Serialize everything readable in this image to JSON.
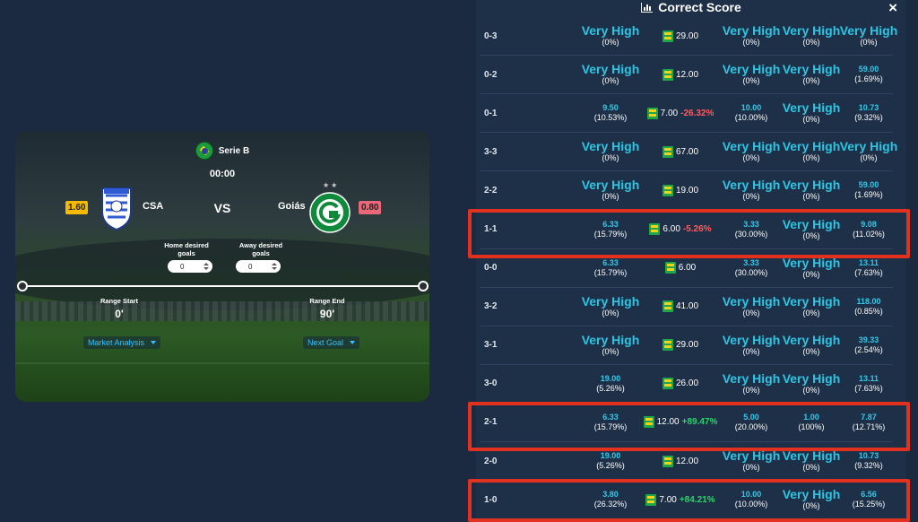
{
  "match": {
    "league": "Serie B",
    "clock": "00:00",
    "home_team": "CSA",
    "away_team": "Goiás",
    "vs": "VS",
    "home_odd": "1.60",
    "away_odd": "0.80",
    "home_goals_label": "Home desired goals",
    "away_goals_label": "Away desired goals",
    "home_goals_value": "0",
    "away_goals_value": "0",
    "range_start_label": "Range Start",
    "range_start_value": "0'",
    "range_end_label": "Range End",
    "range_end_value": "90'",
    "market_analysis": "Market Analysis",
    "next_goal": "Next Goal"
  },
  "panel": {
    "title": "Correct Score",
    "close": "×"
  },
  "rows": [
    {
      "score": "0-3",
      "c1": {
        "v": "Very High",
        "p": "(0%)"
      },
      "bk": "29.00",
      "chg": "",
      "c3": {
        "v": "Very High",
        "p": "(0%)"
      },
      "c4": {
        "v": "Very High",
        "p": "(0%)"
      },
      "c5": {
        "v": "Very High",
        "p": "(0%)"
      }
    },
    {
      "score": "0-2",
      "c1": {
        "v": "Very High",
        "p": "(0%)"
      },
      "bk": "12.00",
      "chg": "",
      "c3": {
        "v": "Very High",
        "p": "(0%)"
      },
      "c4": {
        "v": "Very High",
        "p": "(0%)"
      },
      "c5": {
        "v": "59.00",
        "p": "(1.69%)"
      }
    },
    {
      "score": "0-1",
      "c1": {
        "v": "9.50",
        "p": "(10.53%)"
      },
      "bk": "7.00",
      "chg": "-26.32%",
      "c3": {
        "v": "10.00",
        "p": "(10.00%)"
      },
      "c4": {
        "v": "Very High",
        "p": "(0%)"
      },
      "c5": {
        "v": "10.73",
        "p": "(9.32%)"
      }
    },
    {
      "score": "3-3",
      "c1": {
        "v": "Very High",
        "p": "(0%)"
      },
      "bk": "67.00",
      "chg": "",
      "c3": {
        "v": "Very High",
        "p": "(0%)"
      },
      "c4": {
        "v": "Very High",
        "p": "(0%)"
      },
      "c5": {
        "v": "Very High",
        "p": "(0%)"
      }
    },
    {
      "score": "2-2",
      "c1": {
        "v": "Very High",
        "p": "(0%)"
      },
      "bk": "19.00",
      "chg": "",
      "c3": {
        "v": "Very High",
        "p": "(0%)"
      },
      "c4": {
        "v": "Very High",
        "p": "(0%)"
      },
      "c5": {
        "v": "59.00",
        "p": "(1.69%)"
      }
    },
    {
      "score": "1-1",
      "c1": {
        "v": "6.33",
        "p": "(15.79%)"
      },
      "bk": "6.00",
      "chg": "-5.26%",
      "c3": {
        "v": "3.33",
        "p": "(30.00%)"
      },
      "c4": {
        "v": "Very High",
        "p": "(0%)"
      },
      "c5": {
        "v": "9.08",
        "p": "(11.02%)"
      }
    },
    {
      "score": "0-0",
      "c1": {
        "v": "6.33",
        "p": "(15.79%)"
      },
      "bk": "6.00",
      "chg": "",
      "c3": {
        "v": "3.33",
        "p": "(30.00%)"
      },
      "c4": {
        "v": "Very High",
        "p": "(0%)"
      },
      "c5": {
        "v": "13.11",
        "p": "(7.63%)"
      }
    },
    {
      "score": "3-2",
      "c1": {
        "v": "Very High",
        "p": "(0%)"
      },
      "bk": "41.00",
      "chg": "",
      "c3": {
        "v": "Very High",
        "p": "(0%)"
      },
      "c4": {
        "v": "Very High",
        "p": "(0%)"
      },
      "c5": {
        "v": "118.00",
        "p": "(0.85%)"
      }
    },
    {
      "score": "3-1",
      "c1": {
        "v": "Very High",
        "p": "(0%)"
      },
      "bk": "29.00",
      "chg": "",
      "c3": {
        "v": "Very High",
        "p": "(0%)"
      },
      "c4": {
        "v": "Very High",
        "p": "(0%)"
      },
      "c5": {
        "v": "39.33",
        "p": "(2.54%)"
      }
    },
    {
      "score": "3-0",
      "c1": {
        "v": "19.00",
        "p": "(5.26%)"
      },
      "bk": "26.00",
      "chg": "",
      "c3": {
        "v": "Very High",
        "p": "(0%)"
      },
      "c4": {
        "v": "Very High",
        "p": "(0%)"
      },
      "c5": {
        "v": "13.11",
        "p": "(7.63%)"
      }
    },
    {
      "score": "2-1",
      "c1": {
        "v": "6.33",
        "p": "(15.79%)"
      },
      "bk": "12.00",
      "chg": "+89.47%",
      "c3": {
        "v": "5.00",
        "p": "(20.00%)"
      },
      "c4": {
        "v": "1.00",
        "p": "(100%)"
      },
      "c5": {
        "v": "7.87",
        "p": "(12.71%)"
      }
    },
    {
      "score": "2-0",
      "c1": {
        "v": "19.00",
        "p": "(5.26%)"
      },
      "bk": "12.00",
      "chg": "",
      "c3": {
        "v": "Very High",
        "p": "(0%)"
      },
      "c4": {
        "v": "Very High",
        "p": "(0%)"
      },
      "c5": {
        "v": "10.73",
        "p": "(9.32%)"
      }
    },
    {
      "score": "1-0",
      "c1": {
        "v": "3.80",
        "p": "(26.32%)"
      },
      "bk": "7.00",
      "chg": "+84.21%",
      "c3": {
        "v": "10.00",
        "p": "(10.00%)"
      },
      "c4": {
        "v": "Very High",
        "p": "(0%)"
      },
      "c5": {
        "v": "6.56",
        "p": "(15.25%)"
      }
    }
  ],
  "highlighted_scores": [
    "1-1",
    "2-1",
    "1-0"
  ],
  "colors": {
    "background": "#1b2a41",
    "panel": "#1e3048",
    "accent": "#2fc4e2",
    "highlight": "#e0321e",
    "positive": "#2fd06a",
    "negative": "#ff5a5f"
  }
}
